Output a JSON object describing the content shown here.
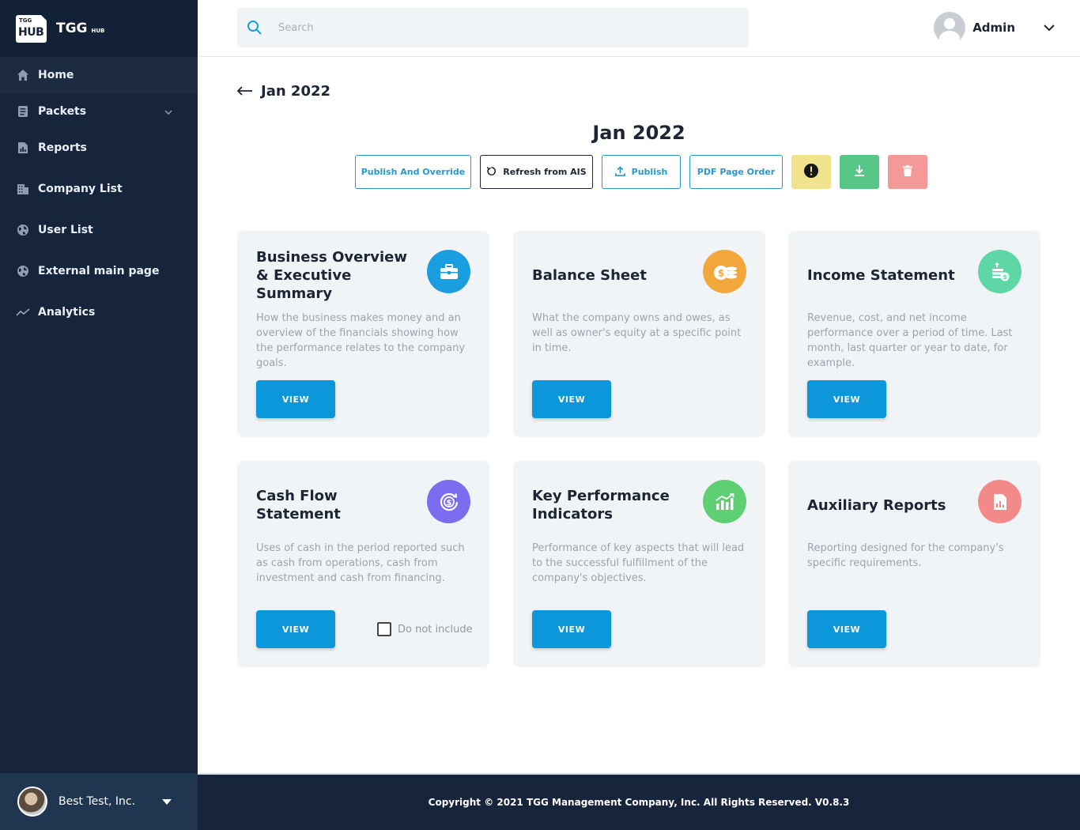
{
  "brand": {
    "logo_top": "TGG",
    "logo_bottom": "HUB",
    "name": "TGG",
    "sub": "HUB"
  },
  "sidebar": {
    "items": [
      {
        "label": "Home",
        "icon": "home-icon"
      },
      {
        "label": "Packets",
        "icon": "packets-icon"
      },
      {
        "label": "Reports",
        "icon": "reports-icon"
      },
      {
        "label": "Company List",
        "icon": "company-icon"
      },
      {
        "label": "User List",
        "icon": "globe-icon"
      },
      {
        "label": "External main page",
        "icon": "globe-icon"
      },
      {
        "label": "Analytics",
        "icon": "analytics-icon"
      }
    ],
    "company": "Best Test, Inc."
  },
  "header": {
    "search_placeholder": "Search",
    "user_name": "Admin"
  },
  "page": {
    "back_label": "Jan 2022",
    "title": "Jan 2022"
  },
  "actions": {
    "publish_override": "Publish And Override",
    "refresh": "Refresh from AIS",
    "publish": "Publish",
    "pdf_order": "PDF Page Order"
  },
  "colors": {
    "accent": "#0b97d9",
    "sidebar": "#16253b"
  },
  "cards": [
    {
      "title": "Business Overview & Executive Summary",
      "desc": "How the business makes money and an overview of the financials showing how the performance relates to the company goals.",
      "button": "VIEW",
      "icon": "briefcase-icon",
      "color": "#1a9ee0"
    },
    {
      "title": "Balance Sheet",
      "desc": "What the company owns and owes, as well as owner's equity at a specific point in time.",
      "button": "VIEW",
      "icon": "coins-icon",
      "color": "#f2a73c"
    },
    {
      "title": "Income Statement",
      "desc": "Revenue, cost, and net income performance over a period of time. Last month, last quarter or year to date, for example.",
      "button": "VIEW",
      "icon": "money-stack-icon",
      "color": "#5fd6a6"
    },
    {
      "title": "Cash Flow Statement",
      "desc": "Uses of cash in the period reported such as cash from operations, cash from investment and cash from financing.",
      "button": "VIEW",
      "icon": "cash-cycle-icon",
      "color": "#7b6cf0",
      "checkbox": "Do not include"
    },
    {
      "title": "Key Performance Indicators",
      "desc": "Performance of key aspects that will lead to the successful fulfillment of the company's objectives.",
      "button": "VIEW",
      "icon": "bar-chart-icon",
      "color": "#5fcf74"
    },
    {
      "title": "Auxiliary Reports",
      "desc": "Reporting designed for the company's specific requirements.",
      "button": "VIEW",
      "icon": "report-doc-icon",
      "color": "#f28a8a"
    }
  ],
  "footer": {
    "copyright": "Copyright © 2021 TGG Management Company, Inc. All Rights Reserved. V0.8.3"
  }
}
